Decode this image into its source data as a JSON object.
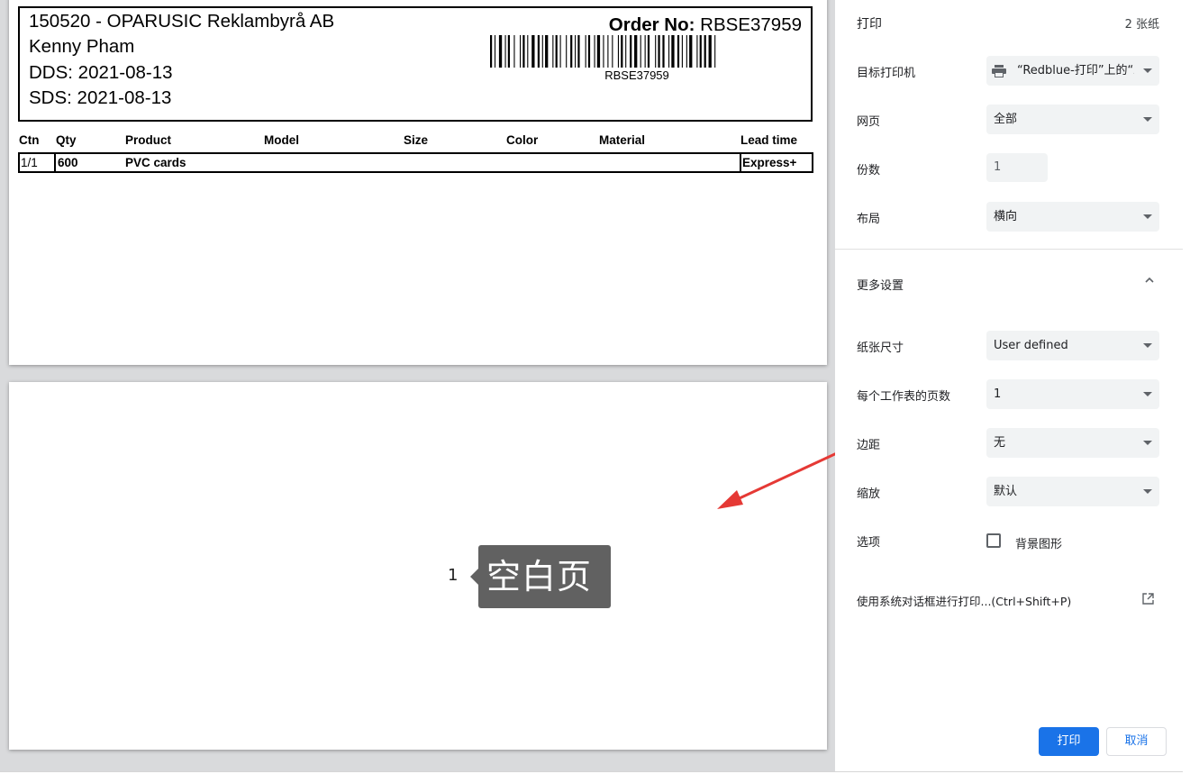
{
  "preview": {
    "page1": {
      "header_lines": [
        "150520 - OPARUSIC Reklambyrå AB",
        "Kenny Pham",
        "DDS: 2021-08-13",
        "SDS: 2021-08-13"
      ],
      "order_label": "Order No:",
      "order_value": " RBSE37959",
      "barcode_text": "RBSE37959",
      "table_headers": [
        "Ctn",
        "Qty",
        "Product",
        "Model",
        "Size",
        "Color",
        "Material",
        "Lead time"
      ],
      "table_row": [
        "1/1",
        "600",
        "PVC cards",
        "Express+"
      ]
    },
    "page2": {
      "page_number": "1",
      "blank_label": "空白页"
    }
  },
  "sidebar": {
    "title": "打印",
    "sheet_count": "2 张纸",
    "destination_label": "目标打印机",
    "destination_value": "“Redblue-打印”上的“ZD",
    "pages_label": "网页",
    "pages_value": "全部",
    "copies_label": "份数",
    "copies_value": "1",
    "layout_label": "布局",
    "layout_value": "横向",
    "more_settings_label": "更多设置",
    "paper_size_label": "纸张尺寸",
    "paper_size_value": "User defined",
    "pages_per_sheet_label": "每个工作表的页数",
    "pages_per_sheet_value": "1",
    "margins_label": "边距",
    "margins_value": "无",
    "scale_label": "缩放",
    "scale_value": "默认",
    "options_label": "选项",
    "background_graphics_label": "背景图形",
    "background_graphics_checked": false,
    "system_dialog_label": "使用系统对话框进行打印...(Ctrl+Shift+P)",
    "print_button": "打印",
    "cancel_button": "取消"
  },
  "colors": {
    "accent": "#1a73e8",
    "annotation_arrow": "#e53935",
    "tooltip_bg": "#616161"
  }
}
